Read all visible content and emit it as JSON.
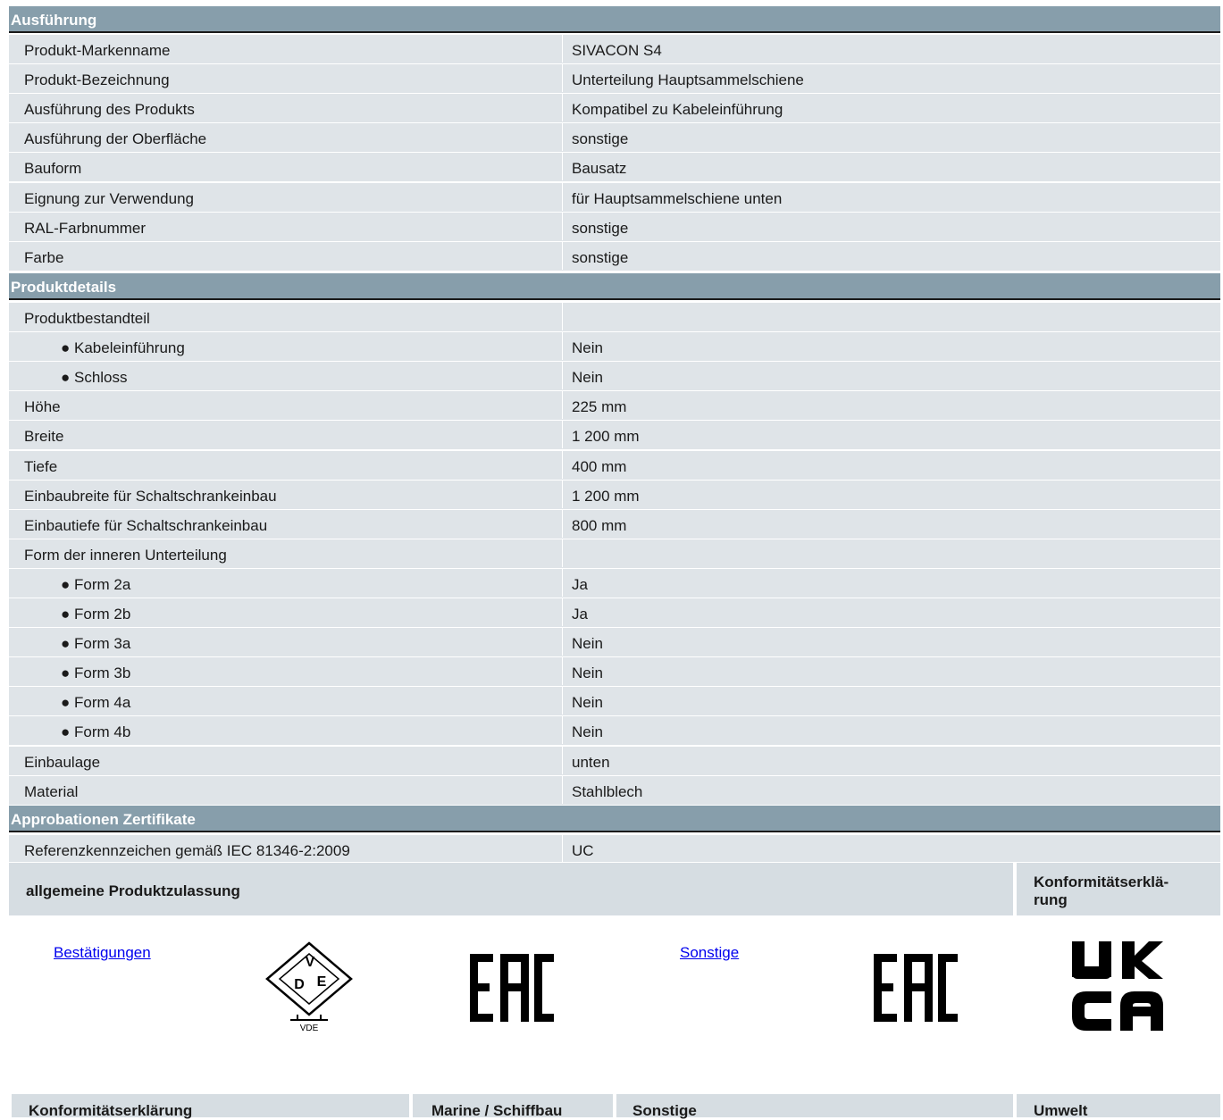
{
  "sections": {
    "ausfuehrung": {
      "title": "Ausführung",
      "rows": [
        {
          "label": "Produkt-Markenname",
          "value": "SIVACON S4"
        },
        {
          "label": "Produkt-Bezeichnung",
          "value": "Unterteilung Hauptsammelschiene"
        },
        {
          "label": "Ausführung des Produkts",
          "value": "Kompatibel zu Kabeleinführung"
        },
        {
          "label": "Ausführung der Oberfläche",
          "value": "sonstige"
        },
        {
          "label": "Bauform",
          "value": "Bausatz"
        },
        {
          "label": "Eignung zur Verwendung",
          "value": "für Hauptsammelschiene unten"
        },
        {
          "label": "RAL-Farbnummer",
          "value": "sonstige"
        },
        {
          "label": "Farbe",
          "value": "sonstige"
        }
      ]
    },
    "produktdetails": {
      "title": "Produktdetails",
      "rows": [
        {
          "label": "Produktbestandteil",
          "value": ""
        },
        {
          "label": "● Kabeleinführung",
          "value": "Nein"
        },
        {
          "label": "● Schloss",
          "value": "Nein"
        },
        {
          "label": "Höhe",
          "value": "225 mm"
        },
        {
          "label": "Breite",
          "value": "1 200 mm"
        },
        {
          "label": "Tiefe",
          "value": "400 mm"
        },
        {
          "label": "Einbaubreite für Schaltschrankeinbau",
          "value": "1 200 mm"
        },
        {
          "label": "Einbautiefe für Schaltschrankeinbau",
          "value": "800 mm"
        },
        {
          "label": "Form der inneren Unterteilung",
          "value": ""
        },
        {
          "label": "● Form 2a",
          "value": "Ja"
        },
        {
          "label": "● Form 2b",
          "value": "Ja"
        },
        {
          "label": "● Form 3a",
          "value": "Nein"
        },
        {
          "label": "● Form 3b",
          "value": "Nein"
        },
        {
          "label": "● Form 4a",
          "value": "Nein"
        },
        {
          "label": "● Form 4b",
          "value": "Nein"
        },
        {
          "label": "Einbaulage",
          "value": "unten"
        },
        {
          "label": "Material",
          "value": "Stahlblech"
        }
      ]
    },
    "approbationen": {
      "title": "Approbationen Zertifikate",
      "rows": [
        {
          "label": "Referenzkennzeichen gemäß IEC 81346-2:2009",
          "value": "UC"
        }
      ]
    }
  },
  "cert_table1": {
    "col1": "allgemeine Produktzulassung",
    "col2_line1": "Konformitätserklä-",
    "col2_line2": "rung"
  },
  "cert_links": {
    "bestaetigungen": "Bestätigungen",
    "sonstige": "Sonstige"
  },
  "logos": {
    "vde_top": "V",
    "vde_left": "D",
    "vde_right": "E",
    "vde_caption": "VDE",
    "eac": "EAC",
    "ukca_line1": "UK",
    "ukca_line2": "CA"
  },
  "cert_table2": {
    "col1": "Konformitätserklärung",
    "col2": "Marine / Schiffbau",
    "col3": "Sonstige",
    "col4": "Umwelt"
  }
}
